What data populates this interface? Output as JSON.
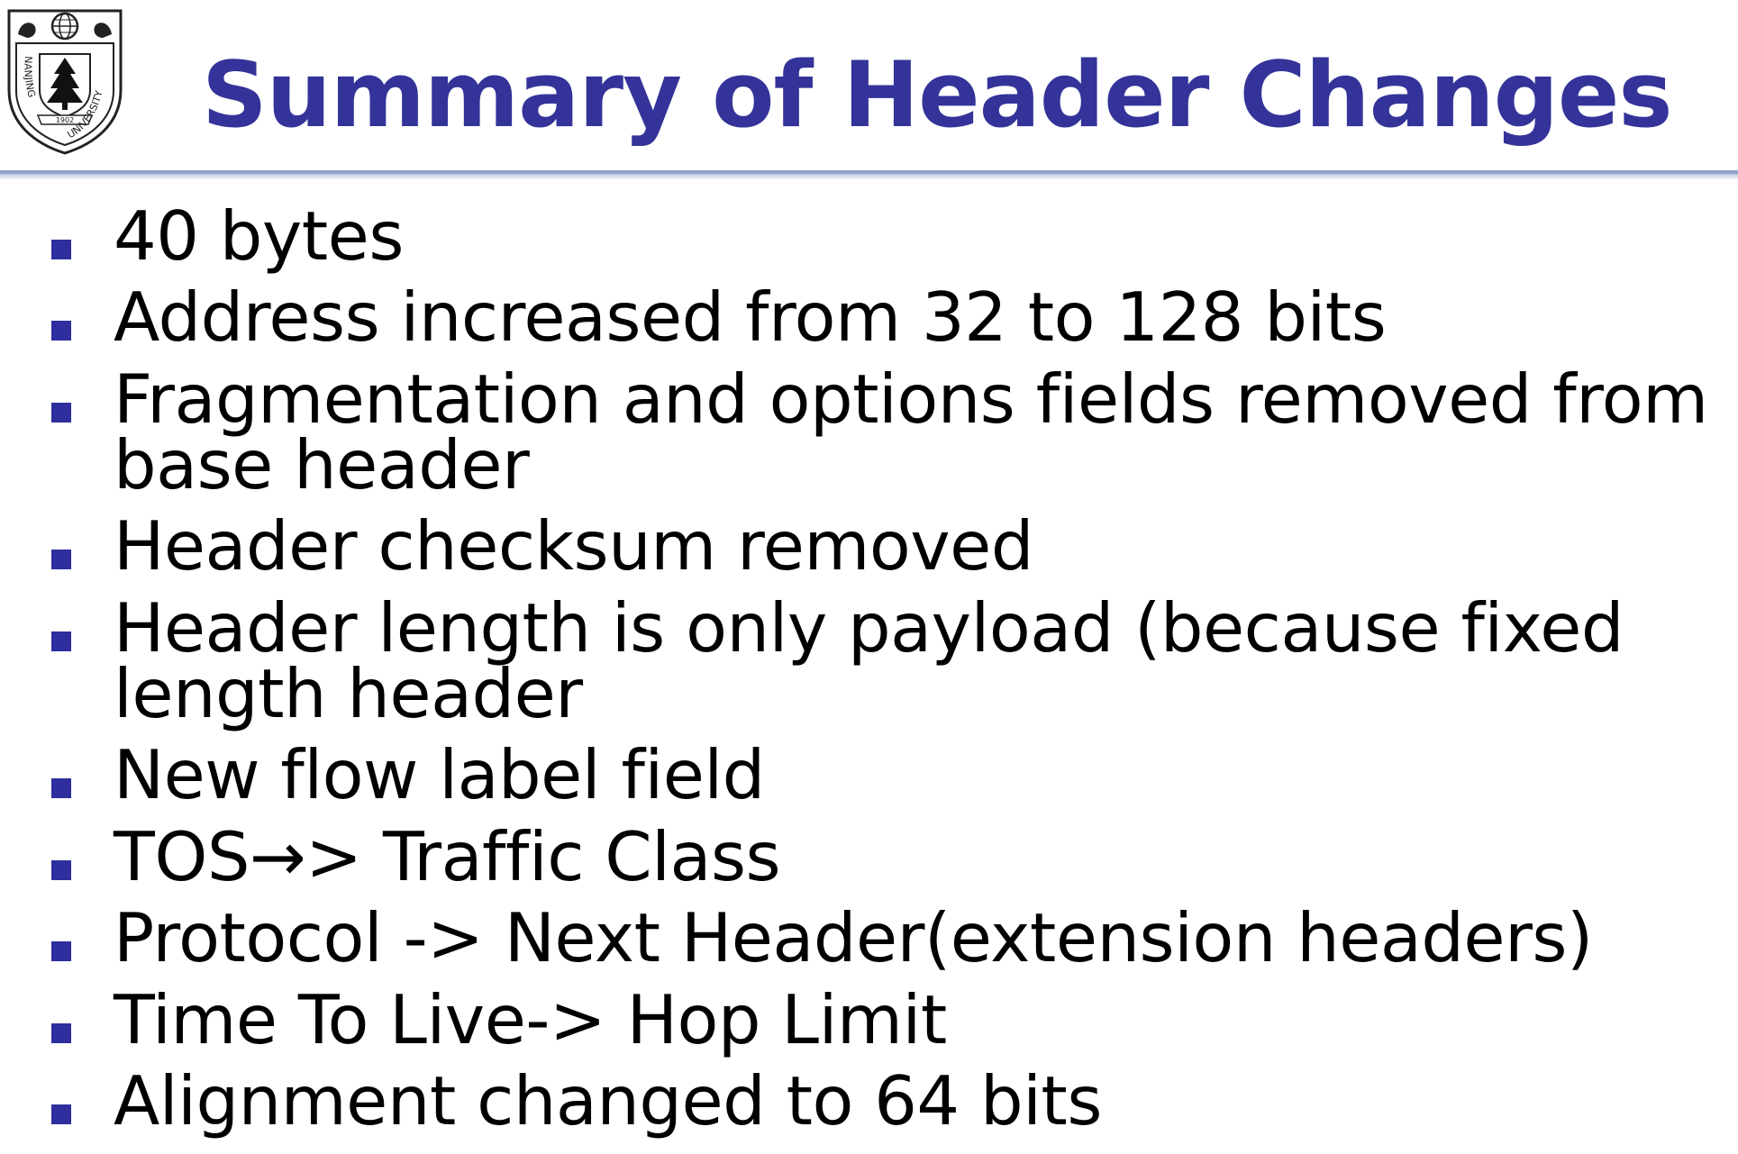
{
  "slide": {
    "title": "Summary of Header Changes",
    "logo": {
      "icon": "university-seal-icon",
      "text": "NANJING UNIVERSITY",
      "year": "1902"
    },
    "bullets": [
      "40 bytes",
      "Address increased from 32 to 128 bits",
      "Fragmentation and options fields removed from base header",
      "Header checksum removed",
      "Header length is only payload (because fixed length header",
      "New flow label field",
      "TOS→> Traffic Class",
      "Protocol -> Next Header(extension headers)",
      "Time To Live-> Hop Limit",
      "Alignment changed to 64 bits"
    ],
    "colors": {
      "title": "#333399",
      "bullet_marker": "#2e2e9e",
      "rule": "#8fa0c8"
    }
  }
}
